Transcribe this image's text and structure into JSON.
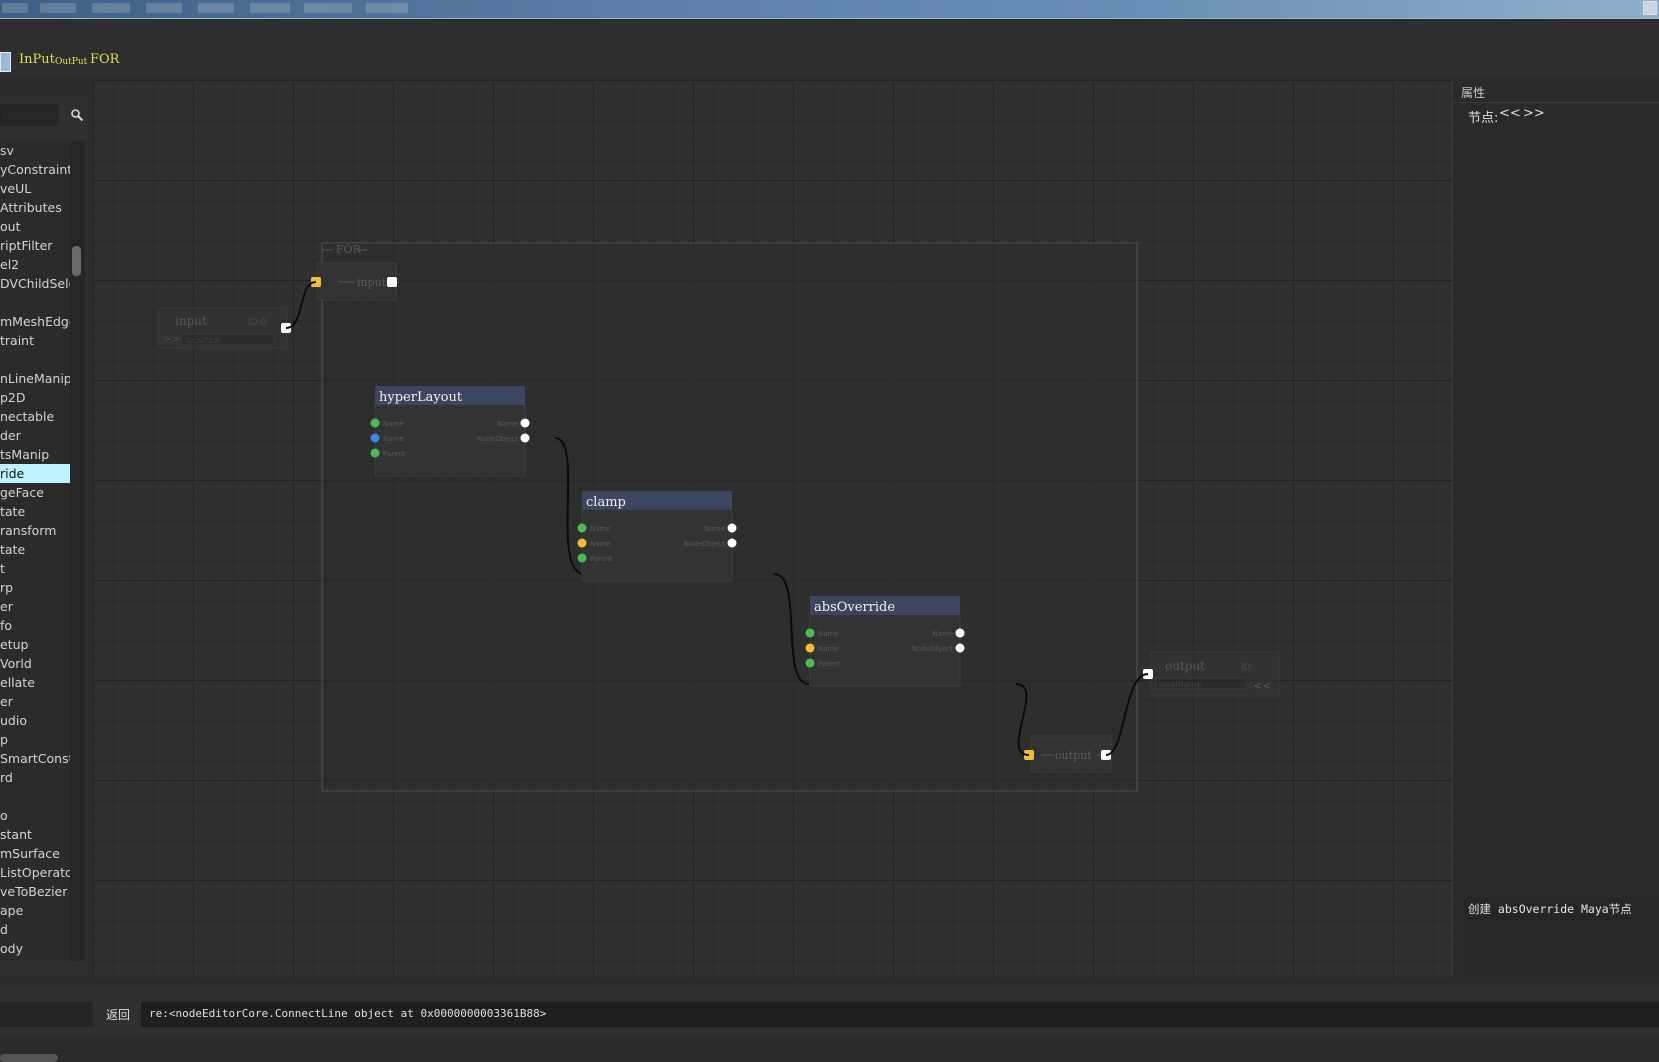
{
  "toolbar": {
    "tab_input": "InPut",
    "tab_output": "OutPut",
    "tab_for": "FOR"
  },
  "node_list": [
    "sv",
    "yConstraint",
    "veUL",
    "Attributes",
    "out",
    "riptFilter",
    "el2",
    "DVChildSelec",
    "",
    "mMeshEdge",
    "traint",
    "",
    "nLineManip",
    "p2D",
    "nectable",
    "der",
    "tsManip",
    "ride",
    "geFace",
    "tate",
    "ransform",
    "tate",
    "t",
    "rp",
    "er",
    "fo",
    "etup",
    "Vorld",
    "ellate",
    "er",
    "udio",
    "p",
    "SmartConstra",
    "rd",
    "",
    "o",
    "stant",
    "mSurface",
    "ListOperatoı",
    "veToBezier",
    "ape",
    "d",
    "ody"
  ],
  "selected_index": 17,
  "canvas": {
    "group_label": "FOR",
    "inner_input_label": "input",
    "inner_output_label": "output",
    "outer_input": {
      "label": "input",
      "id": "ID:0",
      "field": "localPath"
    },
    "outer_output": {
      "label": "output",
      "id": "ID:",
      "field": "localName"
    },
    "nodes": [
      {
        "title": "hyperLayout",
        "inputs": [
          "Name",
          "Name",
          "Parent"
        ],
        "outputs": [
          "Name",
          "NodeObject"
        ]
      },
      {
        "title": "clamp",
        "inputs": [
          "Name",
          "Name",
          "Parent"
        ],
        "outputs": [
          "Name",
          "NodeObject"
        ]
      },
      {
        "title": "absOverride",
        "inputs": [
          "Name",
          "Name",
          "Parent"
        ],
        "outputs": [
          "Name",
          "NodeObject"
        ]
      }
    ]
  },
  "props": {
    "title": "属性",
    "nav_label": "节点:",
    "prev": "<<",
    "next": ">>",
    "info": "创建 absOverride Maya节点"
  },
  "status": {
    "return_label": "返回",
    "command": "re:<nodeEditorCore.ConnectLine object at 0x0000000003361B88>"
  },
  "colors": {
    "port_yellow": "#f0c030",
    "port_green": "#4cbb55",
    "port_blue": "#3a86e0",
    "port_white": "#ffffff",
    "node_header": "#3c4660",
    "selection": "#bff2ff",
    "toolbar_text": "#e9de55"
  }
}
